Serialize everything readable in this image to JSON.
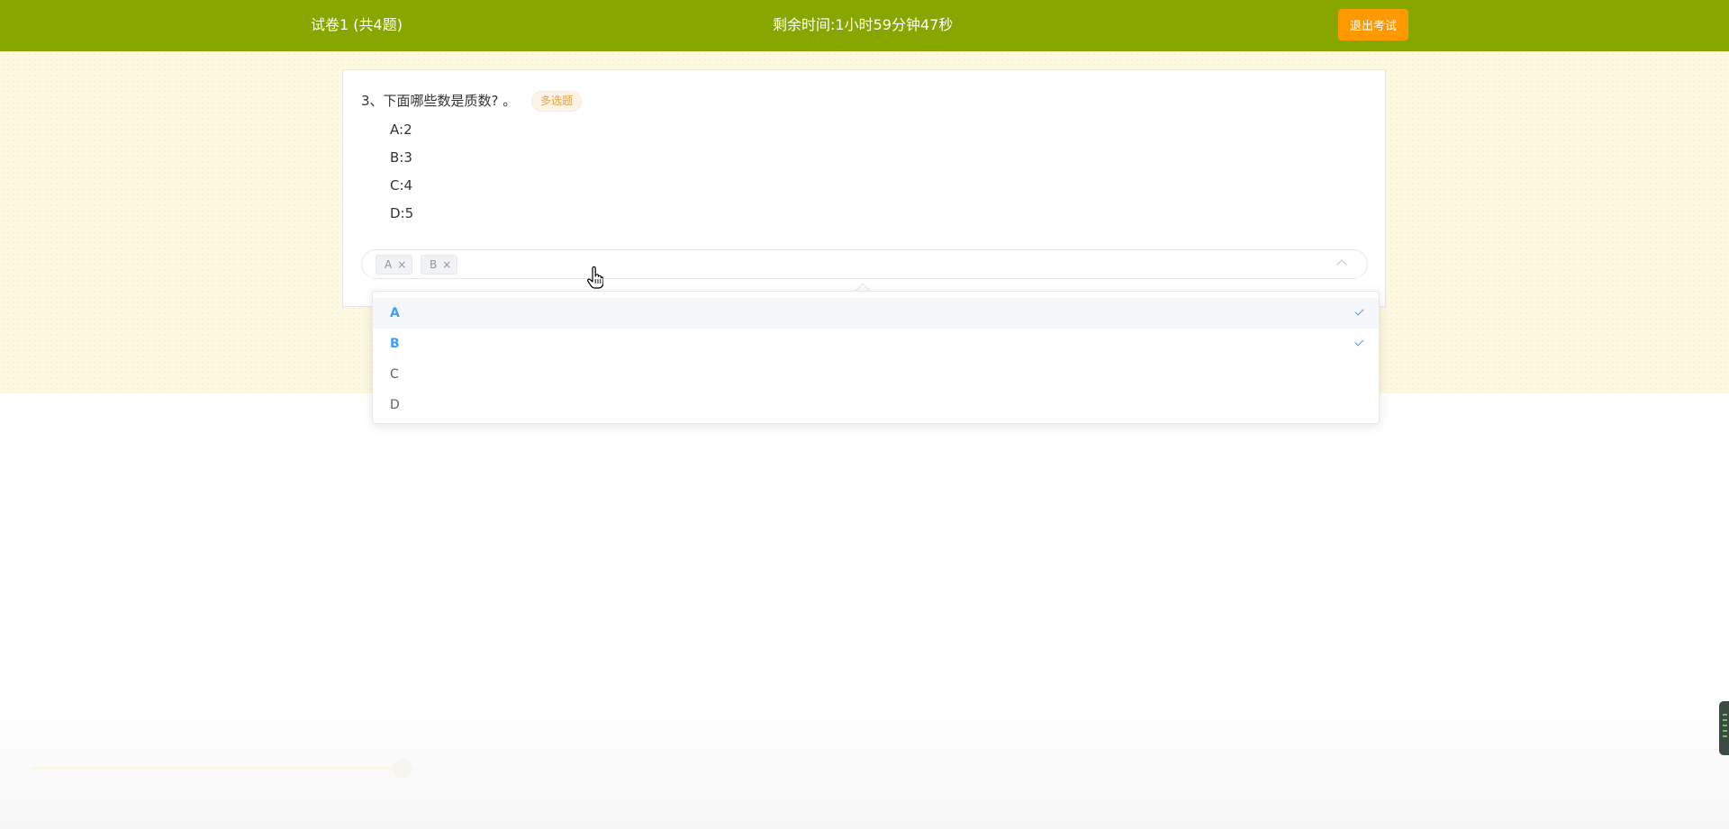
{
  "header": {
    "paper_title": "试卷1 (共4题)",
    "timer_label": "剩余时间:",
    "timer_value": "1小时59分钟47秒",
    "exit_label": "退出考试"
  },
  "colors": {
    "header_bg": "#87a600",
    "exit_button": "#ff9900",
    "selected_text": "#409eff",
    "tag_orange": "#e6a23c"
  },
  "question": {
    "number": "3、",
    "text": "下面哪些数是质数? 。",
    "type_badge": "多选题",
    "options": [
      {
        "letter": "A:",
        "value": "2"
      },
      {
        "letter": "B:",
        "value": "3"
      },
      {
        "letter": "C:",
        "value": "4"
      },
      {
        "letter": "D:",
        "value": "5"
      }
    ]
  },
  "select": {
    "tags": [
      {
        "label": "A",
        "close": "×"
      },
      {
        "label": "B",
        "close": "×"
      }
    ],
    "dropdown_items": [
      {
        "label": "A",
        "selected": true
      },
      {
        "label": "B",
        "selected": true
      },
      {
        "label": "C",
        "selected": false
      },
      {
        "label": "D",
        "selected": false
      }
    ]
  },
  "icons": {
    "select_arrow": "chevron-up-icon",
    "check": "check-icon",
    "cursor": "hand-pointer-icon"
  }
}
